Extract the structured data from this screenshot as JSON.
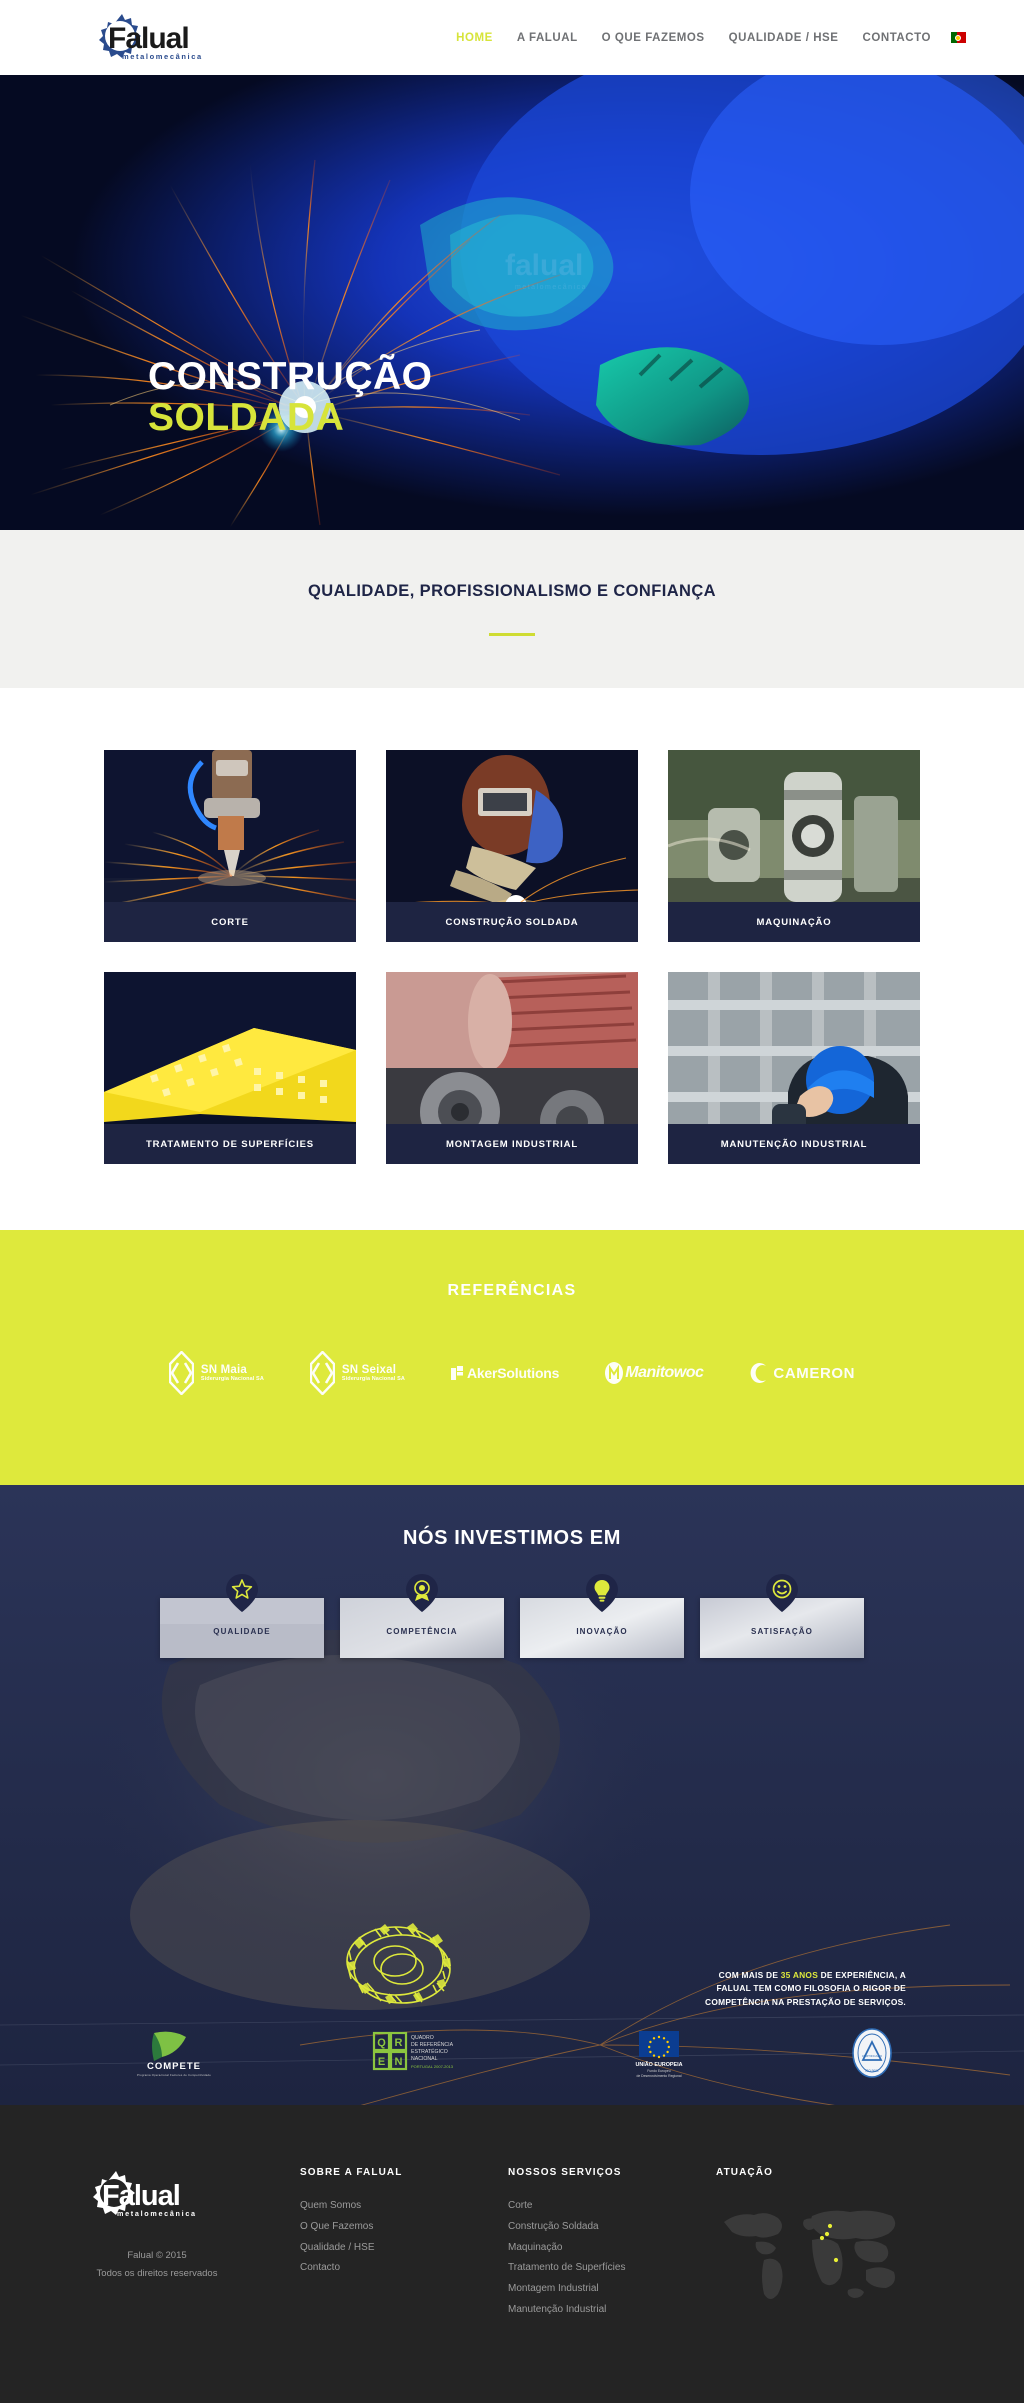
{
  "header": {
    "logo": {
      "name": "Falual",
      "tagline": "metalomecânica"
    },
    "nav": [
      {
        "label": "HOME",
        "active": true
      },
      {
        "label": "A FALUAL",
        "active": false
      },
      {
        "label": "O QUE FAZEMOS",
        "active": false
      },
      {
        "label": "QUALIDADE / HSE",
        "active": false
      },
      {
        "label": "CONTACTO",
        "active": false
      }
    ],
    "language_flag": "portugal-flag"
  },
  "hero": {
    "line1": "CONSTRUÇÃO",
    "line2": "SOLDADA",
    "line1_color": "#ffffff",
    "line2_color": "#d7e43a"
  },
  "tagline": {
    "heading": "QUALIDADE, PROFISSIONALISMO E CONFIANÇA"
  },
  "services": {
    "cards": [
      {
        "label": "CORTE"
      },
      {
        "label": "CONSTRUÇÃO SOLDADA"
      },
      {
        "label": "MAQUINAÇÃO"
      },
      {
        "label": "TRATAMENTO DE SUPERFÍCIES"
      },
      {
        "label": "MONTAGEM INDUSTRIAL"
      },
      {
        "label": "MANUTENÇÃO INDUSTRIAL"
      }
    ]
  },
  "references": {
    "heading": "REFERÊNCIAS",
    "background": "#dee93c",
    "logos": [
      {
        "name": "SN Maia",
        "sub": "Siderurgia Nacional SA"
      },
      {
        "name": "SN Seixal",
        "sub": "Siderurgia Nacional SA"
      },
      {
        "name": "AkerSolutions",
        "sub": ""
      },
      {
        "name": "Manitowoc",
        "sub": ""
      },
      {
        "name": "CAMERON",
        "sub": ""
      }
    ]
  },
  "invest": {
    "heading": "NÓS INVESTIMOS EM",
    "background": "#232b4a",
    "cards": [
      {
        "label": "QUALIDADE",
        "icon": "star-icon"
      },
      {
        "label": "COMPETÊNCIA",
        "icon": "medal-icon"
      },
      {
        "label": "INOVAÇÃO",
        "icon": "lightbulb-icon"
      },
      {
        "label": "SATISFAÇÃO",
        "icon": "smiley-icon"
      }
    ],
    "copy_pre": "COM MAIS DE ",
    "copy_highlight": "35 ANOS",
    "copy_post": " DE EXPERIÊNCIA, A FALUAL TEM COMO FILOSOFIA O RIGOR DE COMPETÊNCIA NA PRESTAÇÃO DE SERVIÇOS.",
    "highlight_color": "#dee93c",
    "partners": [
      {
        "name": "COMPETE",
        "sub": "Programa Operacional Factores de Competitividade"
      },
      {
        "name": "QREN",
        "sub": "Quadro de Referência Estratégico Nacional"
      },
      {
        "name": "UNIÃO EUROPEIA",
        "sub": "Fundo Europeu de Desenvolvimento Regional"
      },
      {
        "name": "certification-seal",
        "sub": ""
      }
    ]
  },
  "footer": {
    "background": "#242424",
    "logo": {
      "name": "Falual",
      "tagline": "metalomecânica"
    },
    "copyright_line1": "Falual © 2015",
    "copyright_line2": "Todos os direitos reservados",
    "columns": [
      {
        "heading": "SOBRE A FALUAL",
        "links": [
          "Quem Somos",
          "O Que Fazemos",
          "Qualidade / HSE",
          "Contacto"
        ]
      },
      {
        "heading": "NOSSOS SERVIÇOS",
        "links": [
          "Corte",
          "Construção Soldada",
          "Maquinação",
          "Tratamento de Superfícies",
          "Montagem Industrial",
          "Manutenção Industrial"
        ]
      }
    ],
    "map_heading": "ATUAÇÃO"
  }
}
